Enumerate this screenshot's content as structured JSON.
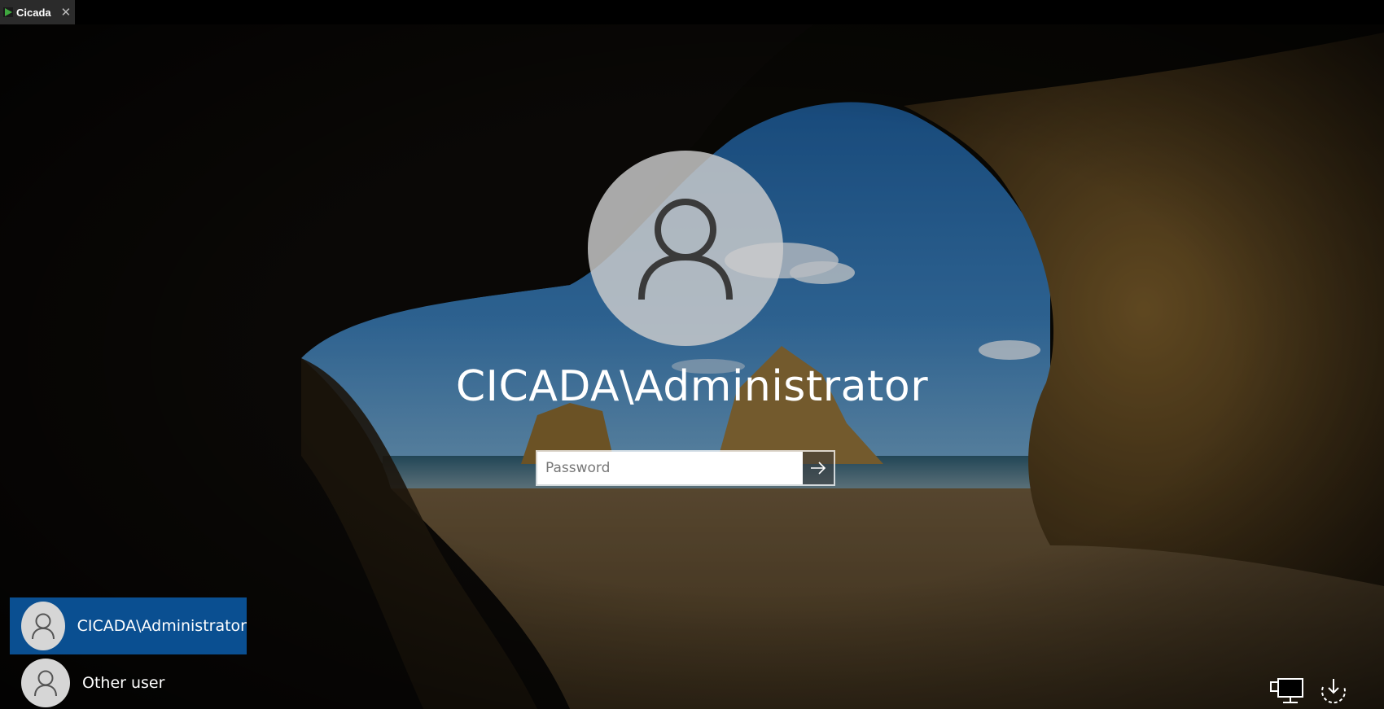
{
  "window": {
    "tab_title": "Cicada",
    "tab_close_glyph": "✕"
  },
  "login": {
    "username": "CICADA\\Administrator",
    "password_placeholder": "Password",
    "password_value": "",
    "submit_icon": "arrow-right-icon"
  },
  "user_list": [
    {
      "label": "CICADA\\Administrator",
      "selected": true
    },
    {
      "label": "Other user",
      "selected": false
    }
  ],
  "corner_icons": [
    "network-icon",
    "power-icon"
  ],
  "colors": {
    "selected_tile": "#0a4f91",
    "avatar_bg": "#cdcdcd",
    "sky": "#2c6aa8",
    "sand": "#8a6a3a",
    "cave": "#0d0b08"
  }
}
